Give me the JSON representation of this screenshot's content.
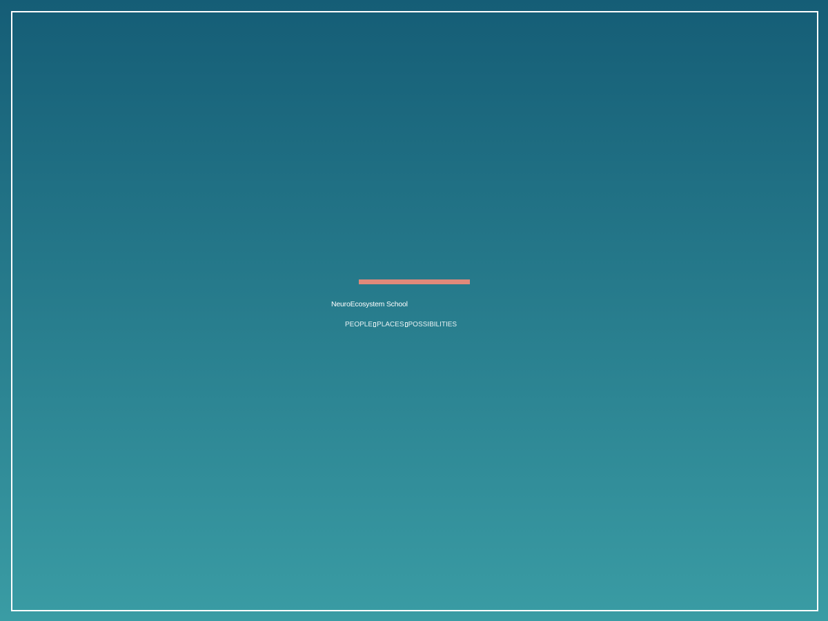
{
  "colors": {
    "background_top": "#155d76",
    "background_bottom": "#3a9ca4",
    "frame": "#ffffff",
    "accent": "#e0897a"
  },
  "brand": {
    "school_name": "NeuroEcosystem School",
    "tagline": [
      "PEOPLE",
      "PLACES",
      "POSSIBILITIES"
    ]
  }
}
